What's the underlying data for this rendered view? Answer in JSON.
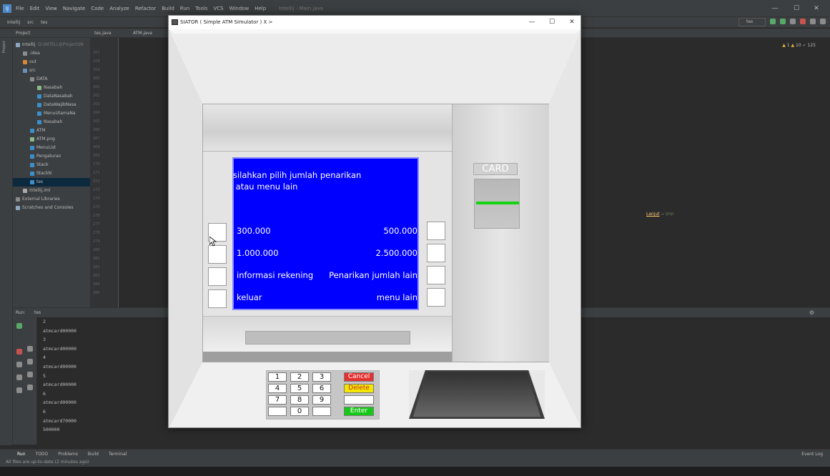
{
  "ide": {
    "menu": [
      "File",
      "Edit",
      "View",
      "Navigate",
      "Code",
      "Analyze",
      "Refactor",
      "Build",
      "Run",
      "Tools",
      "VCS",
      "Window",
      "Help"
    ],
    "title": "Intellij - Main.java",
    "breadcrumbs": [
      "Intellij",
      "src",
      "tes"
    ],
    "run_config": "tes",
    "project_tool": "Project",
    "file_tabs": [
      "tes.java",
      "ATM.java"
    ],
    "inspections": {
      "warnings": "1",
      "weak": "10",
      "typos": "125"
    },
    "tree": [
      {
        "label": "Intellij",
        "extra": "D:\\INTELLIJ\\Project\\IN",
        "indent": 0,
        "icon": "module-icon",
        "color": "#8ca6c2"
      },
      {
        "label": ".idea",
        "indent": 1,
        "icon": "folder-icon",
        "color": "#8c8c8c"
      },
      {
        "label": "out",
        "indent": 1,
        "icon": "folder-icon",
        "color": "#d58a35"
      },
      {
        "label": "src",
        "indent": 1,
        "icon": "folder-icon",
        "color": "#6b8eb6"
      },
      {
        "label": "DATA",
        "indent": 2,
        "icon": "package-icon",
        "color": "#8c8c8c"
      },
      {
        "label": "Nasabah",
        "indent": 3,
        "icon": "interface-icon",
        "color": "#8fb98d"
      },
      {
        "label": "DataNasabah",
        "indent": 3,
        "icon": "class-icon",
        "color": "#3d8fc9"
      },
      {
        "label": "DataWajibNasa",
        "indent": 3,
        "icon": "class-icon",
        "color": "#3d8fc9"
      },
      {
        "label": "MenuUtamaNa",
        "indent": 3,
        "icon": "class-icon",
        "color": "#3d8fc9"
      },
      {
        "label": "Nasabah",
        "indent": 3,
        "icon": "class-icon",
        "color": "#3d8fc9"
      },
      {
        "label": "ATM",
        "indent": 2,
        "icon": "class-icon",
        "color": "#3d8fc9"
      },
      {
        "label": "ATM.png",
        "indent": 2,
        "icon": "image-icon",
        "color": "#8fb98d"
      },
      {
        "label": "MenuList",
        "indent": 2,
        "icon": "class-icon",
        "color": "#3d8fc9"
      },
      {
        "label": "Pengaturan",
        "indent": 2,
        "icon": "class-icon",
        "color": "#3d8fc9"
      },
      {
        "label": "Stack",
        "indent": 2,
        "icon": "class-icon",
        "color": "#3d8fc9"
      },
      {
        "label": "StackN",
        "indent": 2,
        "icon": "class-icon",
        "color": "#3d8fc9"
      },
      {
        "label": "tes",
        "indent": 2,
        "icon": "class-icon",
        "color": "#3d8fc9",
        "selected": true
      },
      {
        "label": "Intellij.iml",
        "indent": 1,
        "icon": "file-icon",
        "color": "#aaaaaa"
      },
      {
        "label": "External Libraries",
        "indent": 0,
        "icon": "library-icon",
        "color": "#8c8c8c"
      },
      {
        "label": "Scratches and Consoles",
        "indent": 0,
        "icon": "scratch-icon",
        "color": "#8ca6c2"
      }
    ],
    "line_numbers": [
      "257",
      "258",
      "259",
      "260",
      "261",
      "262",
      "263",
      "264",
      "265",
      "266",
      "267",
      "268",
      "269",
      "270",
      "271",
      "272",
      "273",
      "274",
      "275",
      "276",
      "277",
      "278",
      "279",
      "280",
      "281",
      "282",
      "283",
      "284",
      "285"
    ],
    "code_fragment": {
      "fn": "Lanjut",
      "op": " -- ",
      "str": "\\n\\n"
    },
    "run": {
      "label": "Run:",
      "tab": "tes",
      "console_lines": [
        "2",
        "atmcard00000",
        "3",
        "atmcard00000",
        "4",
        "atmcard00000",
        "5",
        "atmcard00000",
        "6",
        "atmcard00000",
        "6",
        "atmcard70000",
        "500000"
      ]
    },
    "bottom_tabs": [
      "Run",
      "TODO",
      "Problems",
      "Build",
      "Terminal"
    ],
    "event_log": "Event Log",
    "status": "All files are up-to-date (2 minutes ago)"
  },
  "atm_window": {
    "title": "SIATOR ( Simple ATM Simulator ) X >",
    "controls": {
      "minimize": "—",
      "maximize": "☐",
      "close": "✕"
    },
    "screen": {
      "bg_color": "#0000ff",
      "prompt": "silahkan pilih jumlah penarikan\n atau menu lain",
      "left_options": [
        "300.000",
        "1.000.000",
        "informasi rekening",
        "keluar"
      ],
      "right_options": [
        "500.000",
        "2.500.000",
        "Penarikan jumlah lain",
        "menu lain"
      ]
    },
    "card_label": "CARD",
    "card_led_color": "#13d313",
    "keypad": {
      "keys": [
        [
          "1",
          "2",
          "3"
        ],
        [
          "4",
          "5",
          "6"
        ],
        [
          "7",
          "8",
          "9"
        ],
        [
          "",
          "0",
          ""
        ]
      ],
      "functions": [
        {
          "name": "cancel-key",
          "label": "Cancel",
          "bg": "#e53030",
          "fg": "#ffffff"
        },
        {
          "name": "delete-key",
          "label": "Delete",
          "bg": "#f5e600",
          "fg": "#c03020"
        },
        {
          "name": "blank-key",
          "label": "",
          "bg": "#ffffff",
          "fg": "#000000"
        },
        {
          "name": "enter-key",
          "label": "Enter",
          "bg": "#18c818",
          "fg": "#ffffff"
        }
      ]
    }
  }
}
